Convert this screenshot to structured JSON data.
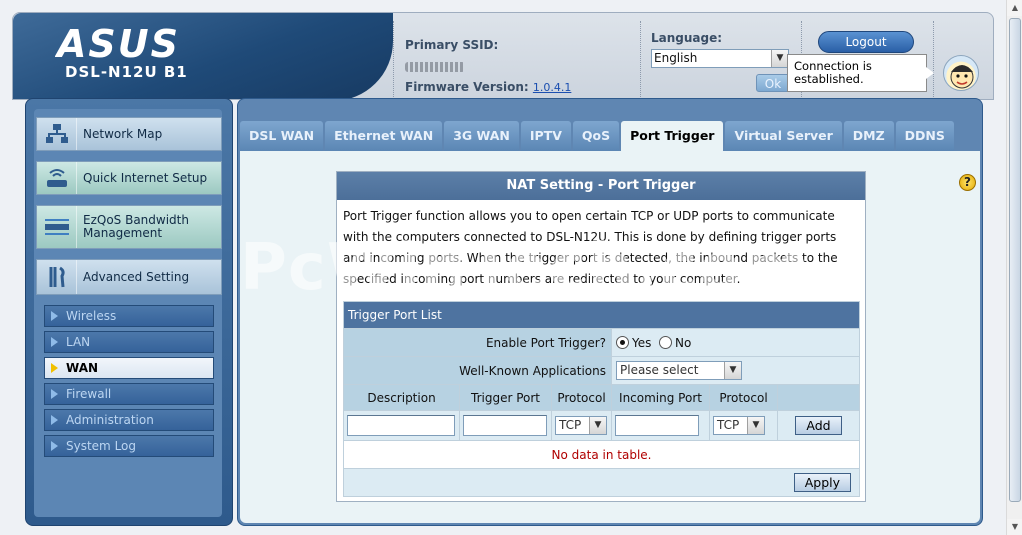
{
  "header": {
    "brand": "ASUS",
    "model": "DSL-N12U B1",
    "primary_ssid_label": "Primary SSID:",
    "firmware_label": "Firmware Version:",
    "firmware_value": "1.0.4.1",
    "language_label": "Language:",
    "language_value": "English",
    "ok_label": "Ok",
    "logout_label": "Logout",
    "status_tooltip": "Connection is established."
  },
  "sidebar": {
    "items": [
      {
        "label": "Network Map",
        "icon": "network-map-icon"
      },
      {
        "label": "Quick Internet Setup",
        "icon": "router-icon"
      },
      {
        "label": "EzQoS Bandwidth Management",
        "icon": "qos-icon"
      },
      {
        "label": "Advanced Setting",
        "icon": "tools-icon"
      }
    ],
    "sub_items": [
      {
        "label": "Wireless"
      },
      {
        "label": "LAN"
      },
      {
        "label": "WAN",
        "active": true
      },
      {
        "label": "Firewall"
      },
      {
        "label": "Administration"
      },
      {
        "label": "System Log"
      }
    ]
  },
  "tabs": [
    {
      "label": "DSL WAN"
    },
    {
      "label": "Ethernet WAN"
    },
    {
      "label": "3G WAN"
    },
    {
      "label": "IPTV"
    },
    {
      "label": "QoS"
    },
    {
      "label": "Port Trigger",
      "active": true
    },
    {
      "label": "Virtual Server"
    },
    {
      "label": "DMZ"
    },
    {
      "label": "DDNS"
    }
  ],
  "watermark": "PcWinTech.com",
  "panel": {
    "title": "NAT Setting - Port Trigger",
    "description": "Port Trigger function allows you to open certain TCP or UDP ports to communicate with the computers connected to DSL-N12U. This is done by defining trigger ports and incoming ports. When the trigger port is detected, the inbound packets to the specified incoming port numbers are redirected to your computer.",
    "list_caption": "Trigger Port List",
    "enable_label": "Enable Port Trigger?",
    "yes_label": "Yes",
    "no_label": "No",
    "enabled": "Yes",
    "wka_label": "Well-Known Applications",
    "wka_placeholder": "Please select",
    "columns": [
      "Description",
      "Trigger Port",
      "Protocol",
      "Incoming Port",
      "Protocol"
    ],
    "protocol_value": "TCP",
    "add_label": "Add",
    "empty_text": "No data in table.",
    "apply_label": "Apply"
  },
  "colors": {
    "brand_blue": "#1f4a78",
    "panel_header": "#4e73a0",
    "empty_text": "#b00000"
  }
}
